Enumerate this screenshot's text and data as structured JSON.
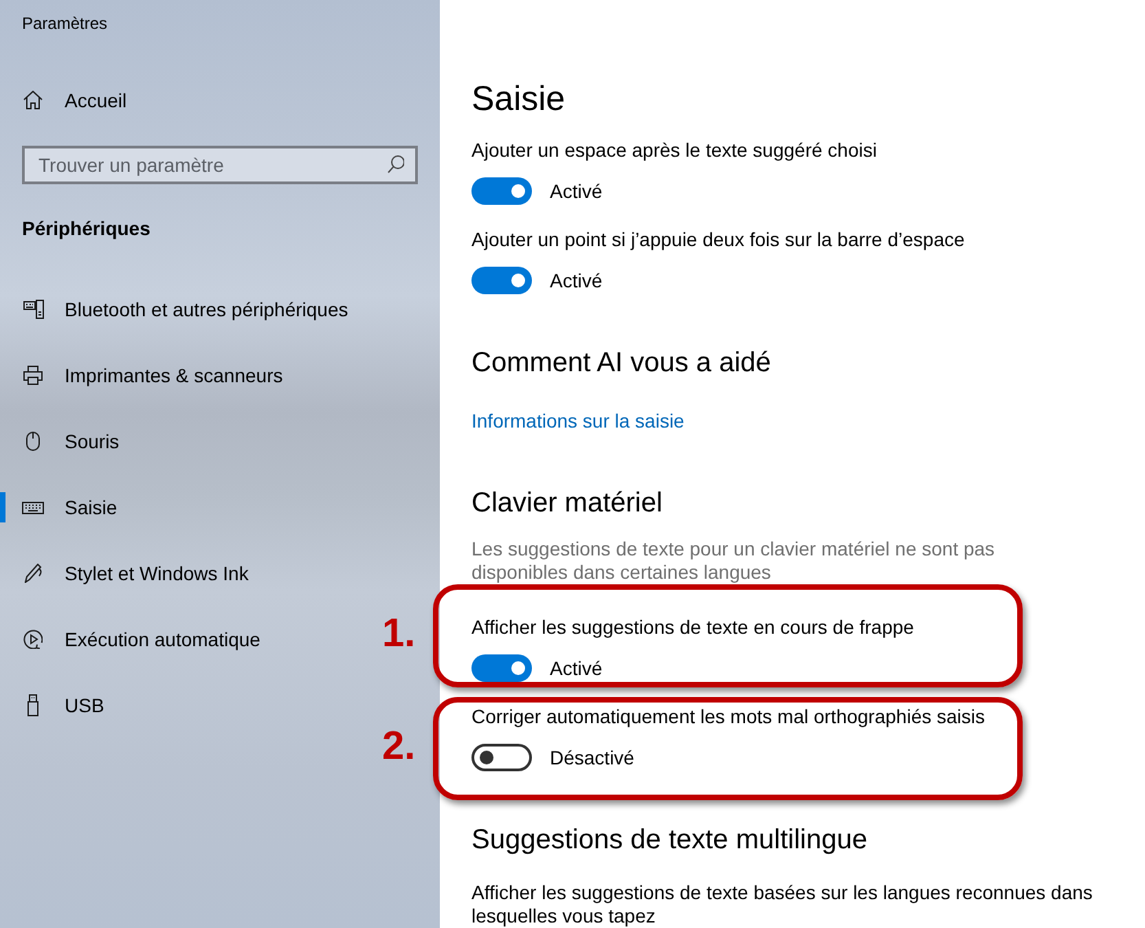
{
  "window": {
    "title": "Paramètres"
  },
  "sidebar": {
    "home": {
      "label": "Accueil"
    },
    "search": {
      "placeholder": "Trouver un paramètre"
    },
    "section_title": "Périphériques",
    "items": [
      {
        "label": "Bluetooth et autres périphériques",
        "kind": "devices",
        "selected": false
      },
      {
        "label": "Imprimantes & scanneurs",
        "kind": "printer",
        "selected": false
      },
      {
        "label": "Souris",
        "kind": "mouse",
        "selected": false
      },
      {
        "label": "Saisie",
        "kind": "keyboard",
        "selected": true
      },
      {
        "label": "Stylet et Windows Ink",
        "kind": "pen",
        "selected": false
      },
      {
        "label": "Exécution automatique",
        "kind": "autoplay",
        "selected": false
      },
      {
        "label": "USB",
        "kind": "usb",
        "selected": false
      }
    ]
  },
  "content": {
    "title": "Saisie",
    "blocks": [
      {
        "kind": "toggle",
        "label": "Ajouter un espace après le texte suggéré choisi",
        "on": true,
        "state": "Activé"
      },
      {
        "kind": "toggle",
        "label": "Ajouter un point si j’appuie deux fois sur la barre d’espace",
        "on": true,
        "state": "Activé"
      },
      {
        "kind": "heading",
        "text": "Comment AI vous a aidé"
      },
      {
        "kind": "link",
        "text": "Informations sur la saisie"
      },
      {
        "kind": "heading",
        "text": "Clavier matériel"
      },
      {
        "kind": "note",
        "text": "Les suggestions de texte pour un clavier matériel ne sont pas disponibles dans certaines langues"
      },
      {
        "kind": "toggle",
        "label": "Afficher les suggestions de texte en cours de frappe",
        "on": true,
        "state": "Activé",
        "callout": "1."
      },
      {
        "kind": "toggle",
        "label": "Corriger automatiquement les mots mal orthographiés saisis",
        "on": false,
        "state": "Désactivé",
        "callout": "2."
      },
      {
        "kind": "heading",
        "text": "Suggestions de texte multilingue"
      },
      {
        "kind": "paragraph",
        "text": "Afficher les suggestions de texte basées sur les langues reconnues dans lesquelles vous tapez"
      }
    ]
  }
}
